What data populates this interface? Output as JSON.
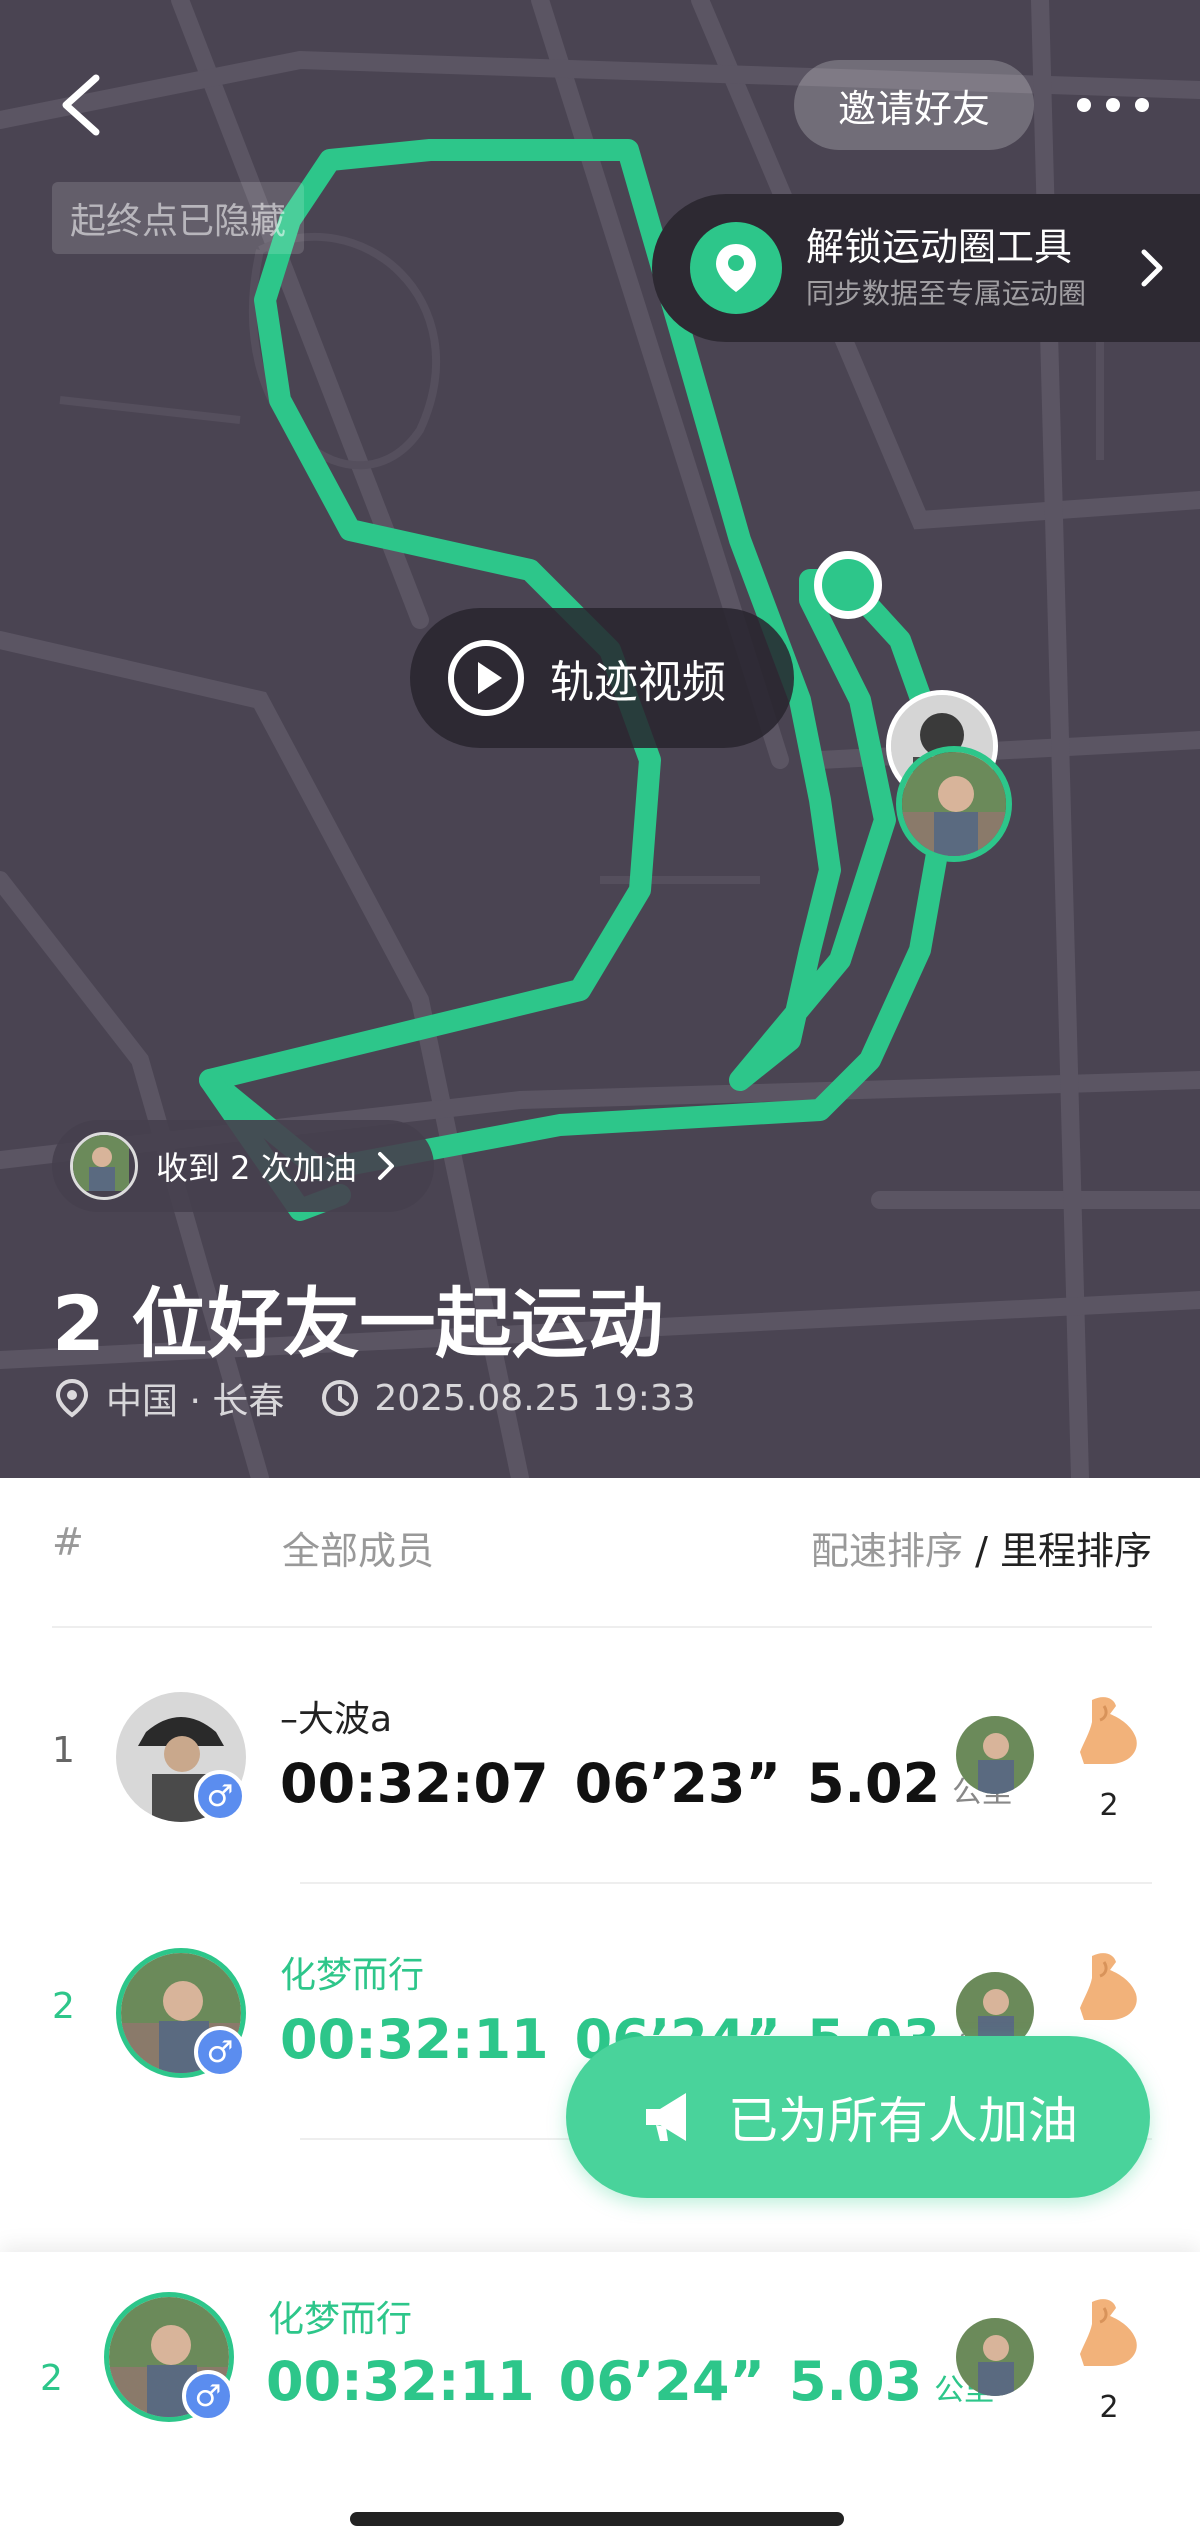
{
  "header": {
    "invite_label": "邀请好友",
    "hidden_badge": "起终点已隐藏"
  },
  "unlock": {
    "title": "解锁运动圈工具",
    "subtitle": "同步数据至专属运动圈"
  },
  "map": {
    "track_video_label": "轨迹视频",
    "cheers_label": "收到 2 次加油",
    "route_color": "#2dc68a"
  },
  "summary": {
    "headline": "2 位好友一起运动",
    "location": "中国 · 长春",
    "datetime": "2025.08.25 19:33"
  },
  "list": {
    "header_hash": "#",
    "header_members": "全部成员",
    "sort_pace": "配速排序",
    "sort_sep": " / ",
    "sort_distance": "里程排序",
    "rows": [
      {
        "rank": "1",
        "name": "–大波a",
        "time": "00:32:07",
        "pace": "06’23”",
        "distance": "5.02",
        "unit": "公里",
        "cheers": "2"
      },
      {
        "rank": "2",
        "name": "化梦而行",
        "time": "00:32:11",
        "pace": "06’24”",
        "distance": "5.03",
        "unit": "公里",
        "cheers": "2"
      }
    ]
  },
  "sticky_row": {
    "rank": "2",
    "name": "化梦而行",
    "time": "00:32:11",
    "pace": "06’24”",
    "distance": "5.03",
    "unit": "公里",
    "cheers": "2"
  },
  "cheer_button_label": "已为所有人加油",
  "gender_symbol": "♂",
  "colors": {
    "accent": "#2dc68a",
    "button": "#49d39b",
    "map_bg": "#4a4452",
    "gender": "#5b8def"
  }
}
